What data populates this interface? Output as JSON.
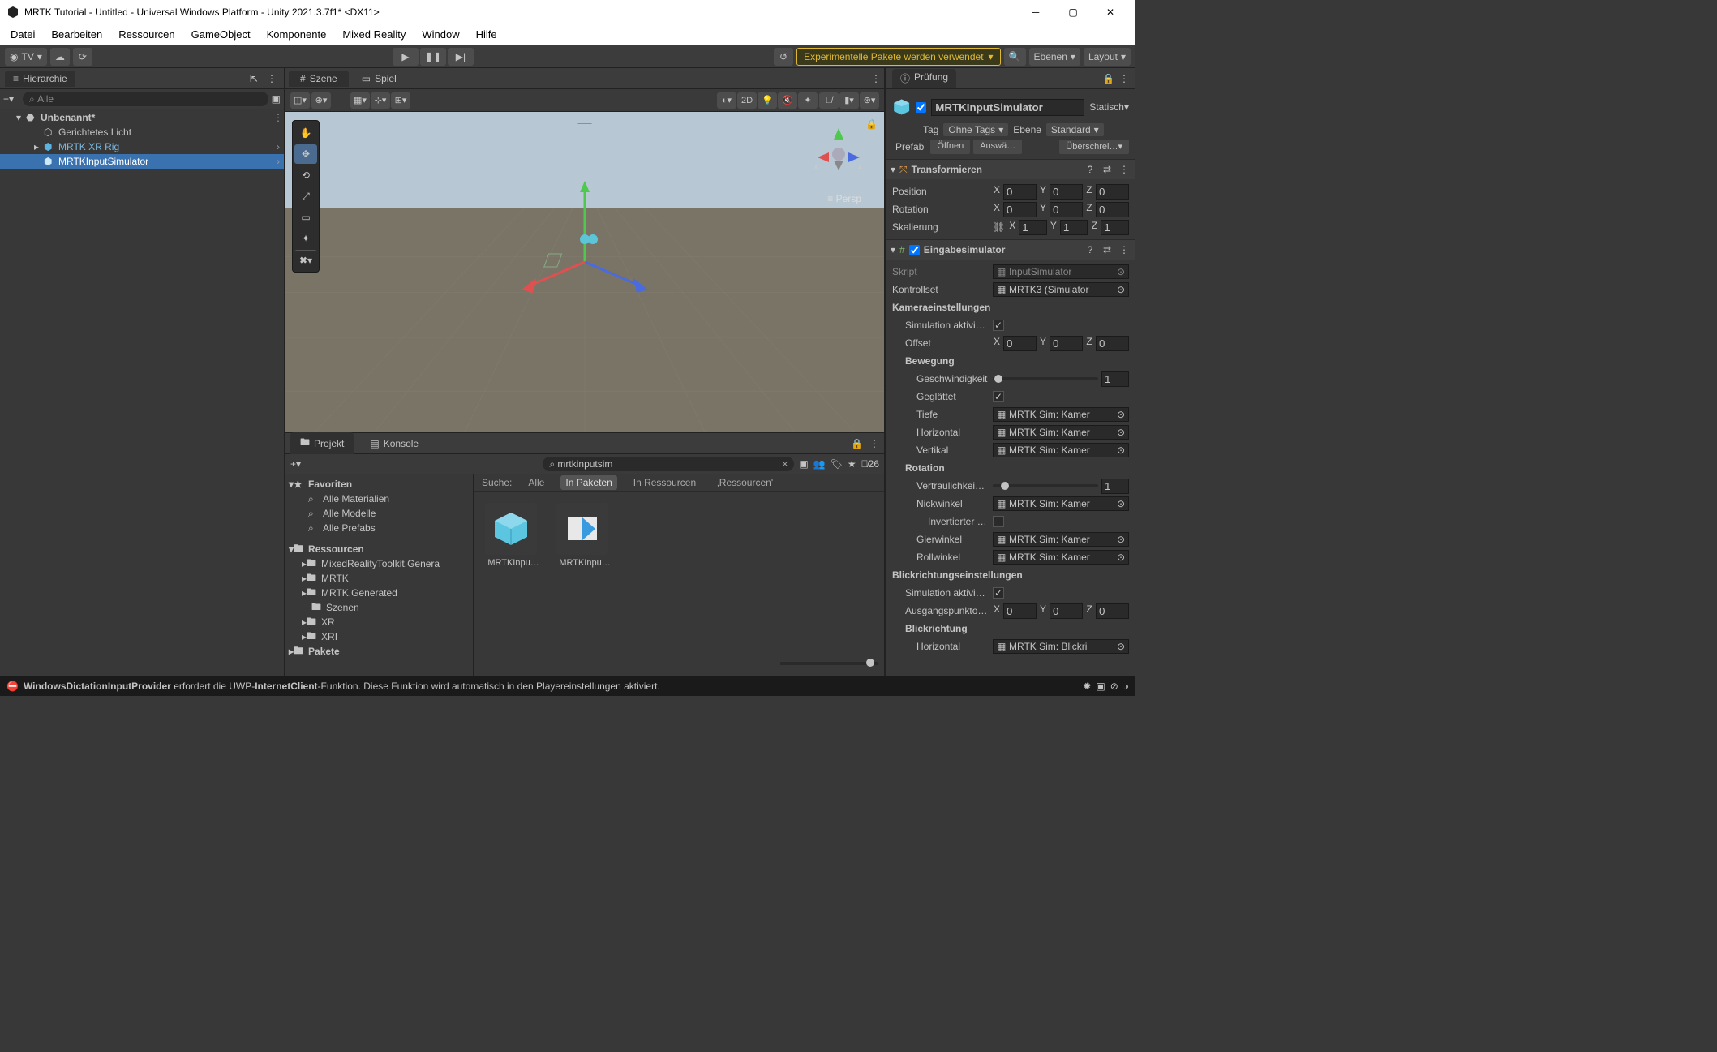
{
  "window": {
    "title": "MRTK Tutorial - Untitled - Universal Windows Platform - Unity 2021.3.7f1* <DX11>"
  },
  "menubar": [
    "Datei",
    "Bearbeiten",
    "Ressourcen",
    "GameObject",
    "Komponente",
    "Mixed Reality",
    "Window",
    "Hilfe"
  ],
  "toolbar": {
    "account": "TV",
    "warn": "Experimentelle Pakete werden verwendet",
    "layers": "Ebenen",
    "layout": "Layout"
  },
  "hierarchy": {
    "title": "Hierarchie",
    "search_placeholder": "Alle",
    "scene": "Unbenannt*",
    "items": [
      "Gerichtetes Licht",
      "MRTK XR Rig",
      "MRTKInputSimulator"
    ]
  },
  "sceneview": {
    "tabs": [
      "Szene",
      "Spiel"
    ],
    "persp": "Persp",
    "btn2d": "2D"
  },
  "project": {
    "tabs": [
      "Projekt",
      "Konsole"
    ],
    "search": "mrtkinputsim",
    "count": "26",
    "filter_label": "Suche:",
    "filters": [
      "Alle",
      "In Paketen",
      "In Ressourcen",
      "‚Ressourcen'"
    ],
    "favorites": {
      "hdr": "Favoriten",
      "items": [
        "Alle Materialien",
        "Alle Modelle",
        "Alle Prefabs"
      ]
    },
    "assets_hdr": "Ressourcen",
    "assets": [
      "MixedRealityToolkit.Genera",
      "MRTK",
      "MRTK.Generated",
      "Szenen",
      "XR",
      "XRI"
    ],
    "packages": "Pakete",
    "results": [
      "MRTKInpu…",
      "MRTKInpu…"
    ]
  },
  "inspector": {
    "title": "Prüfung",
    "go_name": "MRTKInputSimulator",
    "static": "Statisch",
    "tag_label": "Tag",
    "tag": "Ohne Tags",
    "layer_label": "Ebene",
    "layer": "Standard",
    "prefab": "Prefab",
    "open": "Öffnen",
    "select": "Auswä…",
    "overrides": "Überschrei…",
    "transform": {
      "title": "Transformieren",
      "pos": "Position",
      "rot": "Rotation",
      "scale": "Skalierung",
      "px": "0",
      "py": "0",
      "pz": "0",
      "rx": "0",
      "ry": "0",
      "rz": "0",
      "sx": "1",
      "sy": "1",
      "sz": "1"
    },
    "sim": {
      "title": "Eingabesimulator",
      "script_l": "Skript",
      "script": "InputSimulator",
      "ctrl_l": "Kontrollset",
      "ctrl": "MRTK3 (Simulator",
      "cam_hdr": "Kameraeinstellungen",
      "sim_on": "Simulation aktivie…",
      "offset": "Offset",
      "ox": "0",
      "oy": "0",
      "oz": "0",
      "move_hdr": "Bewegung",
      "speed": "Geschwindigkeit",
      "speed_v": "1",
      "smooth": "Geglättet",
      "depth": "Tiefe",
      "depth_v": "MRTK Sim: Kamer",
      "horiz": "Horizontal",
      "horiz_v": "MRTK Sim: Kamer",
      "vert": "Vertikal",
      "vert_v": "MRTK Sim: Kamer",
      "rot_hdr": "Rotation",
      "sens": "Vertraulichkei…",
      "sens_v": "1",
      "pitch": "Nickwinkel",
      "pitch_v": "MRTK Sim: Kamer",
      "invert": "Invertierter …",
      "yaw": "Gierwinkel",
      "yaw_v": "MRTK Sim: Kamer",
      "roll": "Rollwinkel",
      "roll_v": "MRTK Sim: Kamer",
      "look_hdr": "Blickrichtungseinstellungen",
      "look_sim": "Simulation aktivi…",
      "origin": "Ausgangspunkto…",
      "origx": "0",
      "origy": "0",
      "origz": "0",
      "look_dir": "Blickrichtung",
      "look_h": "Horizontal",
      "look_h_v": "MRTK Sim: Blickri"
    }
  },
  "status": {
    "msg_pre": "WindowsDictationInputProvider",
    "msg": " erfordert die UWP-",
    "msg_b": "InternetClient",
    "msg_post": "-Funktion. Diese Funktion wird automatisch in den Playereinstellungen aktiviert."
  }
}
